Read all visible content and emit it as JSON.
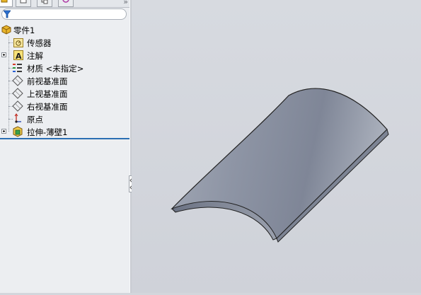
{
  "feature_tree": {
    "root": {
      "label": "零件1",
      "icon": "part-icon"
    },
    "items": [
      {
        "label": "传感器",
        "icon": "sensor-icon",
        "expandable": false
      },
      {
        "label": "注解",
        "icon": "annotation-icon",
        "expandable": true
      },
      {
        "label": "材质 <未指定>",
        "icon": "material-icon",
        "expandable": false
      },
      {
        "label": "前视基准面",
        "icon": "plane-icon",
        "expandable": false
      },
      {
        "label": "上视基准面",
        "icon": "plane-icon",
        "expandable": false
      },
      {
        "label": "右视基准面",
        "icon": "plane-icon",
        "expandable": false
      },
      {
        "label": "原点",
        "icon": "origin-icon",
        "expandable": false
      },
      {
        "label": "拉伸-薄壁1",
        "icon": "extrude-feature-icon",
        "expandable": true
      }
    ]
  },
  "tabs": [
    {
      "name": "featuremanager-tab",
      "icon": "feature-tree-icon",
      "active": true
    },
    {
      "name": "propertymanager-tab",
      "icon": "property-sheet-icon",
      "active": false
    },
    {
      "name": "configurationmanager-tab",
      "icon": "configuration-icon",
      "active": false
    },
    {
      "name": "dimxpert-tab",
      "icon": "dimxpert-icon",
      "active": false
    }
  ],
  "tab_overflow_glyph": "»",
  "colors": {
    "panel_bg": "#eceef1",
    "viewport_bg": "#d3d6dc",
    "rollback_bar": "#2b6fb3",
    "model_face": "#8f97a8"
  }
}
